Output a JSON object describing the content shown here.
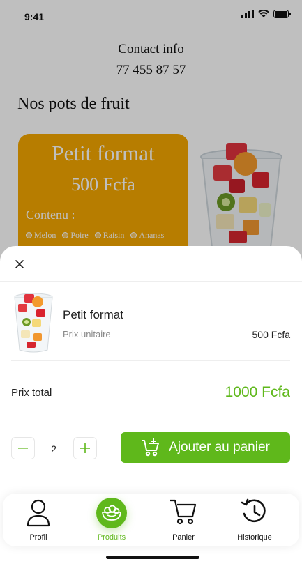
{
  "status": {
    "time": "9:41"
  },
  "contact": {
    "title": "Contact info",
    "phone": "77 455 87 57"
  },
  "section": {
    "title": "Nos pots de fruit"
  },
  "product_card": {
    "title": "Petit format",
    "price": "500 Fcfa",
    "contenu_label": "Contenu :",
    "fruits": [
      "Melon",
      "Poire",
      "Raisin",
      "Ananas"
    ],
    "color": "#f5a700"
  },
  "sheet": {
    "item": {
      "name": "Petit format",
      "subtitle": "Prix unitaire",
      "price": "500 Fcfa"
    },
    "total": {
      "label": "Prix total",
      "value": "1000 Fcfa"
    },
    "quantity": "2",
    "add_button": {
      "label": "Ajouter au panier",
      "icon": "cart-add-icon"
    }
  },
  "tabbar": {
    "tabs": [
      {
        "label": "Profil",
        "icon": "user-icon",
        "active": false
      },
      {
        "label": "Produits",
        "icon": "fruit-bowl-icon",
        "active": true
      },
      {
        "label": "Panier",
        "icon": "cart-icon",
        "active": false
      },
      {
        "label": "Historique",
        "icon": "history-icon",
        "active": false
      }
    ]
  },
  "colors": {
    "accent": "#5fb81b",
    "card": "#f5a700"
  }
}
